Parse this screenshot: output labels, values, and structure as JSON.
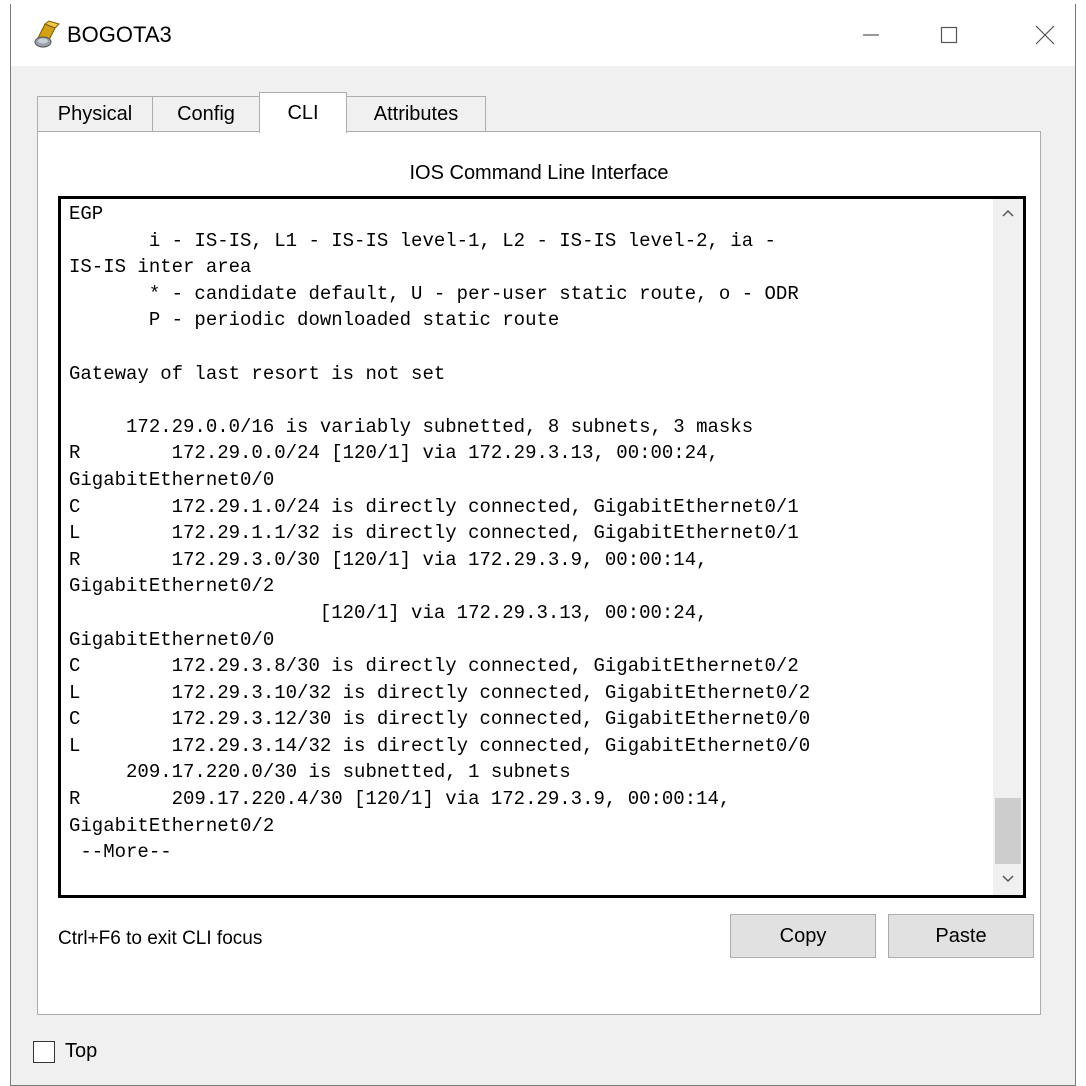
{
  "window": {
    "title": "BOGOTA3",
    "icon": "router-app-icon",
    "controls": [
      "minimize-icon",
      "maximize-icon",
      "close-icon"
    ]
  },
  "tabs": [
    {
      "label": "Physical",
      "active": false
    },
    {
      "label": "Config",
      "active": false
    },
    {
      "label": "CLI",
      "active": true
    },
    {
      "label": "Attributes",
      "active": false
    }
  ],
  "panel": {
    "heading": "IOS Command Line Interface"
  },
  "cli": {
    "lines": [
      "EGP",
      "       i - IS-IS, L1 - IS-IS level-1, L2 - IS-IS level-2, ia -",
      "IS-IS inter area",
      "       * - candidate default, U - per-user static route, o - ODR",
      "       P - periodic downloaded static route",
      "",
      "Gateway of last resort is not set",
      "",
      "     172.29.0.0/16 is variably subnetted, 8 subnets, 3 masks",
      "R        172.29.0.0/24 [120/1] via 172.29.3.13, 00:00:24,",
      "GigabitEthernet0/0",
      "C        172.29.1.0/24 is directly connected, GigabitEthernet0/1",
      "L        172.29.1.1/32 is directly connected, GigabitEthernet0/1",
      "R        172.29.3.0/30 [120/1] via 172.29.3.9, 00:00:14,",
      "GigabitEthernet0/2",
      "                      [120/1] via 172.29.3.13, 00:00:24,",
      "GigabitEthernet0/0",
      "C        172.29.3.8/30 is directly connected, GigabitEthernet0/2",
      "L        172.29.3.10/32 is directly connected, GigabitEthernet0/2",
      "C        172.29.3.12/30 is directly connected, GigabitEthernet0/0",
      "L        172.29.3.14/32 is directly connected, GigabitEthernet0/0",
      "     209.17.220.0/30 is subnetted, 1 subnets",
      "R        209.17.220.4/30 [120/1] via 172.29.3.9, 00:00:14,",
      "GigabitEthernet0/2",
      " --More--"
    ],
    "scroll_position": 0.92
  },
  "footer": {
    "hint": "Ctrl+F6 to exit CLI focus",
    "copy_label": "Copy",
    "paste_label": "Paste"
  },
  "top_checkbox": {
    "label": "Top",
    "checked": false
  },
  "colors": {
    "window_bg": "#f0f0f0",
    "titlebar_bg": "#ffffff",
    "border": "#adadad",
    "cli_border": "#000000",
    "scroll_thumb": "#cdcdcd"
  }
}
